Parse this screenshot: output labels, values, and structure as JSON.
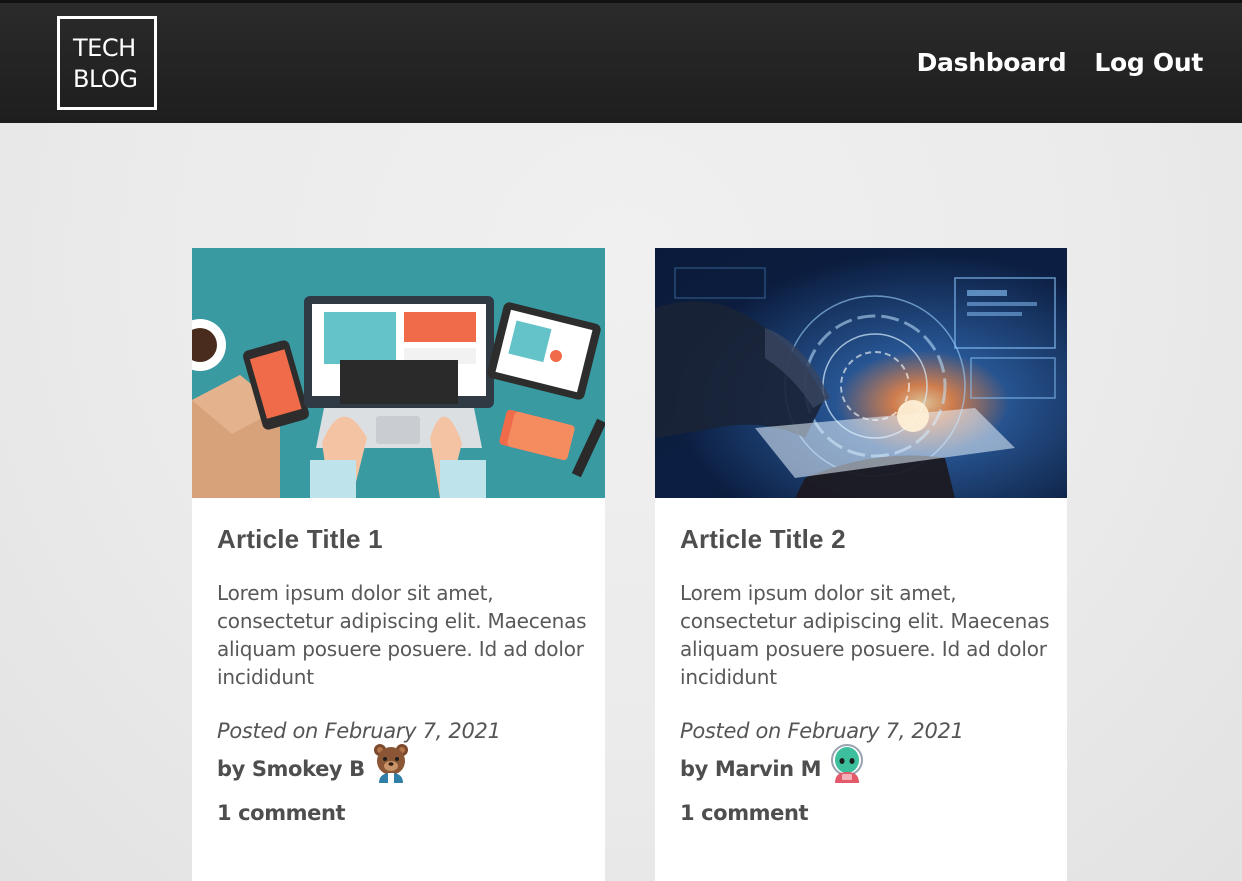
{
  "header": {
    "logo_line1": "TECH",
    "logo_line2": "BLOG",
    "nav": [
      {
        "label": "Dashboard"
      },
      {
        "label": "Log Out"
      }
    ]
  },
  "articles": [
    {
      "title": "Article Title 1",
      "excerpt": "Lorem ipsum dolor sit amet, consectetur adipiscing elit. Maecenas aliquam posuere posuere. Id ad dolor incididunt",
      "date": "Posted on February 7, 2021",
      "author": "by Smokey B",
      "comments": "1 comment",
      "image_icon": "online-shopping-illustration",
      "avatar_icon": "bear-avatar-icon"
    },
    {
      "title": "Article Title 2",
      "excerpt": "Lorem ipsum dolor sit amet, consectetur adipiscing elit. Maecenas aliquam posuere posuere. Id ad dolor incididunt",
      "date": "Posted on February 7, 2021",
      "author": "by Marvin M",
      "comments": "1 comment",
      "image_icon": "digital-tech-hand-illustration",
      "avatar_icon": "alien-avatar-icon"
    }
  ],
  "colors": {
    "header_bg": "#242424",
    "page_bg": "#ebebeb",
    "card_bg": "#ffffff",
    "text": "#555555",
    "header_text": "#ffffff"
  }
}
